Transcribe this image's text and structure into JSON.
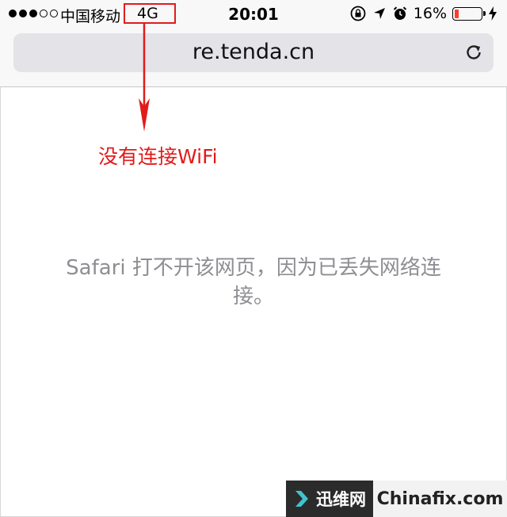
{
  "status_bar": {
    "signal_bars_filled": 3,
    "signal_bars_total": 5,
    "carrier": "中国移动",
    "network": "4G",
    "time": "20:01",
    "battery_percent": "16%",
    "battery_level": 0.16,
    "icons": [
      "rotation-lock-icon",
      "location-arrow-icon",
      "alarm-icon",
      "charging-bolt-icon"
    ]
  },
  "address_bar": {
    "url": "re.tenda.cn",
    "reload_icon": "reload-icon"
  },
  "page": {
    "error_message": "Safari 打不开该网页，因为已丢失网络连接。"
  },
  "annotation": {
    "callout_text": "没有连接WiFi",
    "color": "#e21b1b"
  },
  "watermark": {
    "brand": "迅维网",
    "site": "Chinafix.com"
  },
  "colors": {
    "accent_red": "#e21b1b",
    "battery_low": "#ff3b30",
    "message_gray": "#8e8e93",
    "address_bar_bg": "#e3e3e8"
  }
}
